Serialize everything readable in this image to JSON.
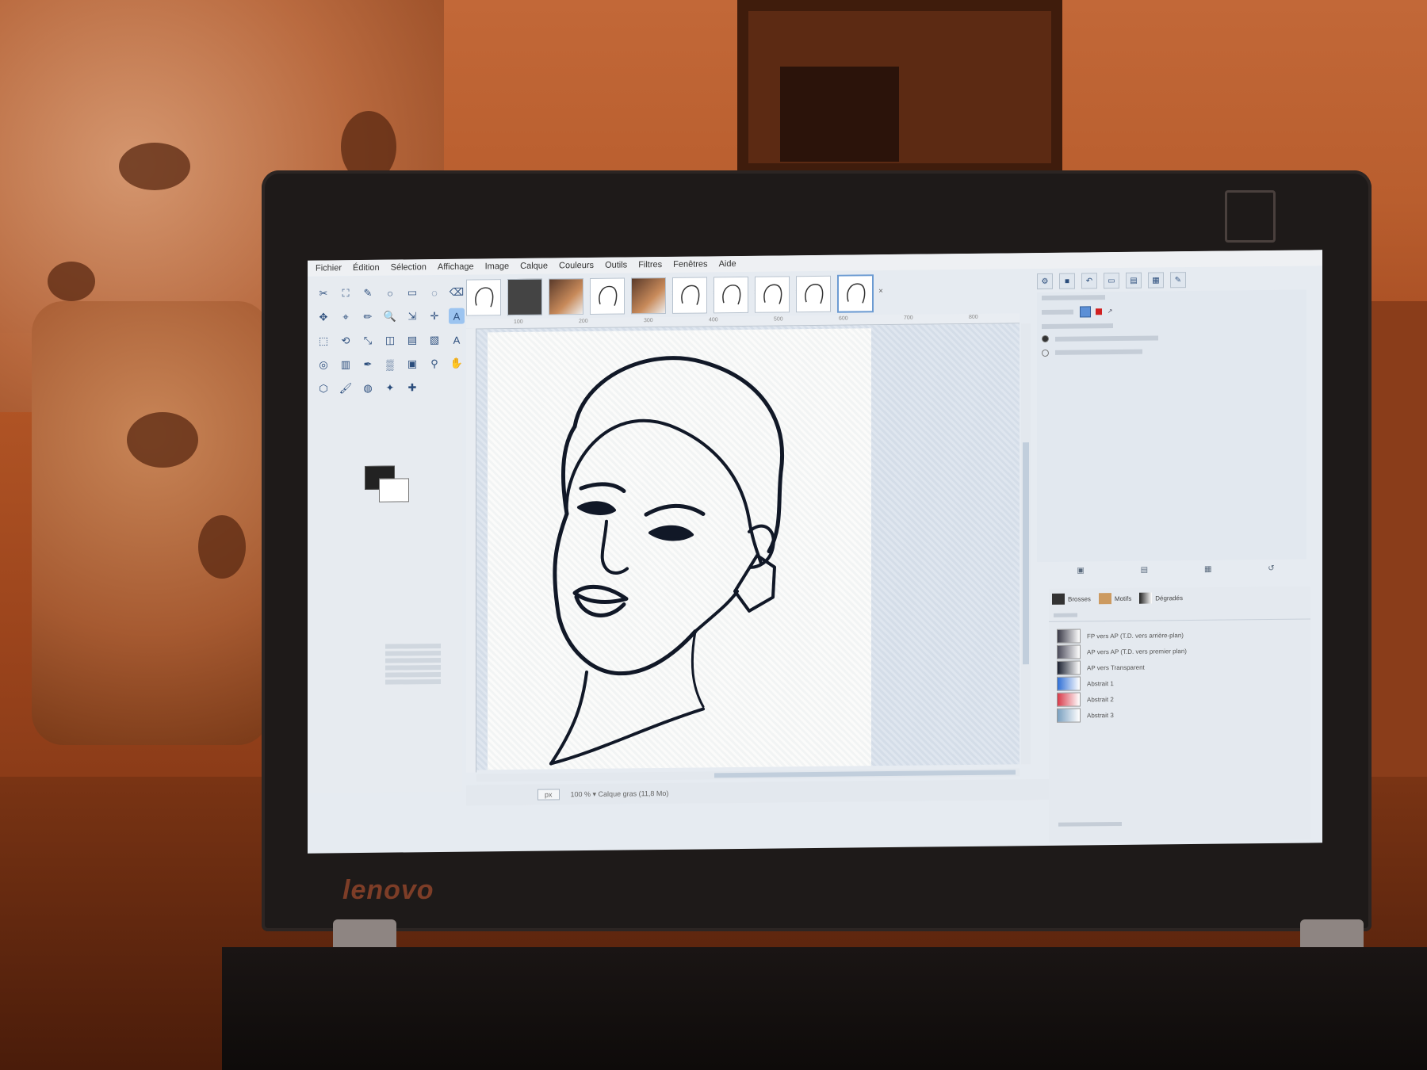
{
  "menu": [
    "Fichier",
    "Édition",
    "Sélection",
    "Affichage",
    "Image",
    "Calque",
    "Couleurs",
    "Outils",
    "Filtres",
    "Fenêtres",
    "Aide"
  ],
  "toolbox": {
    "tools": [
      "✂",
      "⛶",
      "✎",
      "○",
      "▭",
      "◌",
      "⌫",
      "✥",
      "⌖",
      "✏",
      "🔍",
      "⇲",
      "✛",
      "A",
      "⬚",
      "⟲",
      "⤡",
      "◫",
      "▤",
      "▧",
      "A",
      "◎",
      "▥",
      "✒",
      "▒",
      "▣",
      "⚲",
      "✋",
      "⬡",
      "🖌",
      "◍",
      "✦",
      "✚"
    ],
    "active_index": 13,
    "colors": {
      "foreground": "#222222",
      "background": "#ffffff"
    }
  },
  "image_tabs": [
    {
      "style": "sketch",
      "active": false
    },
    {
      "style": "dark",
      "active": false
    },
    {
      "style": "photo",
      "active": false
    },
    {
      "style": "sketch",
      "active": false
    },
    {
      "style": "photo",
      "active": false
    },
    {
      "style": "sketch",
      "active": false
    },
    {
      "style": "sketch",
      "active": false
    },
    {
      "style": "sketch",
      "active": false
    },
    {
      "style": "sketch",
      "active": false
    },
    {
      "style": "sketch",
      "active": true
    }
  ],
  "ruler_ticks": [
    "100",
    "200",
    "300",
    "400",
    "500",
    "600",
    "700",
    "800"
  ],
  "status": {
    "unit": "px",
    "zoom_text": "100 % ▾ Calque gras (11,8 Mo)"
  },
  "layers": {
    "tabs": [
      "Brosses",
      "Motifs",
      "Dégradés"
    ],
    "items": [
      {
        "name": "FP vers AP (T.D. vers arrière-plan)",
        "swatch": "#3a3a48"
      },
      {
        "name": "AP vers AP (T.D. vers premier plan)",
        "swatch": "#4a4a5a"
      },
      {
        "name": "AP vers Transparent",
        "swatch": "#1a2030"
      },
      {
        "name": "Abstrait 1",
        "swatch": "#2f6fd6"
      },
      {
        "name": "Abstrait 2",
        "swatch": "#d83a4a"
      },
      {
        "name": "Abstrait 3",
        "swatch": "#7aa0c0"
      }
    ]
  },
  "colors": {
    "accent": "#6c9bd2",
    "drawing_stroke": "#111827"
  }
}
